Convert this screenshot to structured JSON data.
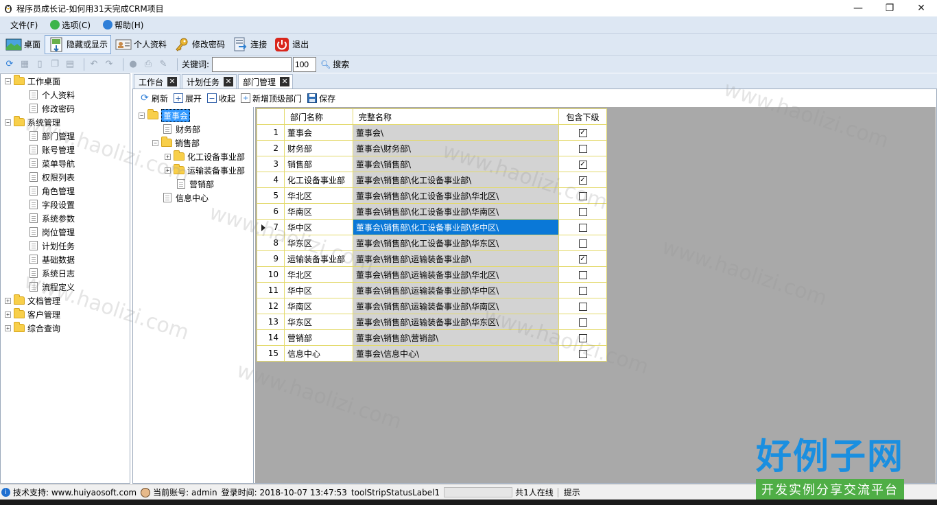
{
  "window": {
    "title": "程序员成长记-如何用31天完成CRM项目"
  },
  "menu": [
    {
      "label": "文件(F)",
      "icon": ""
    },
    {
      "label": "选项(C)",
      "icon": "options-icon"
    },
    {
      "label": "帮助(H)",
      "icon": "help-icon"
    }
  ],
  "toolbar": {
    "desktop": "桌面",
    "toggle": "隐藏或显示",
    "profile": "个人资料",
    "password": "修改密码",
    "connect": "连接",
    "exit": "退出"
  },
  "searchbar": {
    "keyword_label": "关键词:",
    "keyword_value": "",
    "limit_value": "100",
    "search_label": "搜索"
  },
  "nav": {
    "groups": [
      {
        "label": "工作桌面",
        "expanded": true,
        "children": [
          "个人资料",
          "修改密码"
        ]
      },
      {
        "label": "系统管理",
        "expanded": true,
        "children": [
          "部门管理",
          "账号管理",
          "菜单导航",
          "权限列表",
          "角色管理",
          "字段设置",
          "系统参数",
          "岗位管理",
          "计划任务",
          "基础数据",
          "系统日志",
          "流程定义"
        ]
      },
      {
        "label": "文档管理",
        "expanded": false,
        "children": []
      },
      {
        "label": "客户管理",
        "expanded": false,
        "children": []
      },
      {
        "label": "综合查询",
        "expanded": false,
        "children": []
      }
    ]
  },
  "tabs": [
    {
      "label": "工作台",
      "selected": false
    },
    {
      "label": "计划任务",
      "selected": false
    },
    {
      "label": "部门管理",
      "selected": true
    }
  ],
  "subtoolbar": {
    "refresh": "刷新",
    "expand": "展开",
    "collapse": "收起",
    "add_top": "新增顶级部门",
    "save": "保存"
  },
  "dept_tree": {
    "root": "董事会",
    "finance": "财务部",
    "sales": "销售部",
    "chem": "化工设备事业部",
    "transport": "运输装备事业部",
    "marketing": "营销部",
    "info": "信息中心"
  },
  "grid": {
    "headers": {
      "name": "部门名称",
      "full": "完整名称",
      "include": "包含下级"
    },
    "rows": [
      {
        "no": "1",
        "name": "董事会",
        "full": "董事会\\",
        "checked": true
      },
      {
        "no": "2",
        "name": "财务部",
        "full": "董事会\\财务部\\",
        "checked": false
      },
      {
        "no": "3",
        "name": "销售部",
        "full": "董事会\\销售部\\",
        "checked": true
      },
      {
        "no": "4",
        "name": "化工设备事业部",
        "full": "董事会\\销售部\\化工设备事业部\\",
        "checked": true
      },
      {
        "no": "5",
        "name": "华北区",
        "full": "董事会\\销售部\\化工设备事业部\\华北区\\",
        "checked": false
      },
      {
        "no": "6",
        "name": "华南区",
        "full": "董事会\\销售部\\化工设备事业部\\华南区\\",
        "checked": false
      },
      {
        "no": "7",
        "name": "华中区",
        "full": "董事会\\销售部\\化工设备事业部\\华中区\\",
        "checked": false,
        "current": true
      },
      {
        "no": "8",
        "name": "华东区",
        "full": "董事会\\销售部\\化工设备事业部\\华东区\\",
        "checked": false
      },
      {
        "no": "9",
        "name": "运输装备事业部",
        "full": "董事会\\销售部\\运输装备事业部\\",
        "checked": true
      },
      {
        "no": "10",
        "name": "华北区",
        "full": "董事会\\销售部\\运输装备事业部\\华北区\\",
        "checked": false
      },
      {
        "no": "11",
        "name": "华中区",
        "full": "董事会\\销售部\\运输装备事业部\\华中区\\",
        "checked": false
      },
      {
        "no": "12",
        "name": "华南区",
        "full": "董事会\\销售部\\运输装备事业部\\华南区\\",
        "checked": false
      },
      {
        "no": "13",
        "name": "华东区",
        "full": "董事会\\销售部\\运输装备事业部\\华东区\\",
        "checked": false
      },
      {
        "no": "14",
        "name": "营销部",
        "full": "董事会\\销售部\\营销部\\",
        "checked": false
      },
      {
        "no": "15",
        "name": "信息中心",
        "full": "董事会\\信息中心\\",
        "checked": false
      }
    ]
  },
  "status": {
    "support": "技术支持: www.huiyaosoft.com",
    "account": "当前账号: admin",
    "login": "登录时间: 2018-10-07 13:47:53",
    "label1": "toolStripStatusLabel1",
    "online": "共1人在线",
    "tip": "提示"
  },
  "watermark": "www.haolizi.com",
  "brand": {
    "big": "好例子网",
    "small": "开发实例分享交流平台"
  },
  "colors": {
    "selection": "#0a78d7",
    "chrome": "#dde7f3",
    "grid_border": "#e3d96a"
  }
}
